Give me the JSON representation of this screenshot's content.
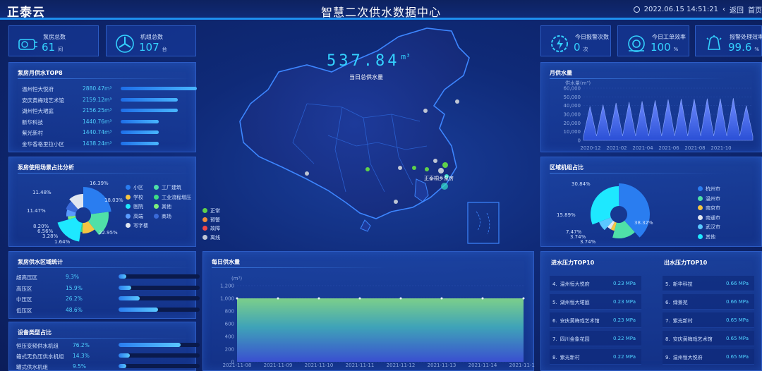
{
  "header": {
    "logo": "正泰云",
    "title": "智慧二次供水数据中心",
    "datetime": "2022.06.15 14:51:21",
    "back_label": "返回",
    "home_label": "首页"
  },
  "left_stats": [
    {
      "label": "泵房总数",
      "value": "61",
      "unit": "间",
      "icon": "pump-room-icon"
    },
    {
      "label": "机组总数",
      "value": "107",
      "unit": "台",
      "icon": "fan-unit-icon"
    }
  ],
  "right_stats": [
    {
      "label": "今日报警次数",
      "value": "0",
      "unit": "次",
      "icon": "alarm-gear-icon"
    },
    {
      "label": "今日工单效率",
      "value": "100",
      "unit": "%",
      "icon": "workorder-icon"
    },
    {
      "label": "报警处理效率",
      "value": "99.6",
      "unit": "%",
      "icon": "alarm-handle-icon"
    }
  ],
  "top8": {
    "title": "泵房月供水TOP8",
    "items": [
      {
        "name": "温州恒大悦府",
        "value": "2880.47m³",
        "ratio": 1.0
      },
      {
        "name": "安庆黄梅戏艺术馆",
        "value": "2159.12m³",
        "ratio": 0.75
      },
      {
        "name": "湖州恒大珺庭",
        "value": "2156.25m³",
        "ratio": 0.75
      },
      {
        "name": "新华科技",
        "value": "1440.76m³",
        "ratio": 0.5
      },
      {
        "name": "紫光新村",
        "value": "1440.74m³",
        "ratio": 0.5
      },
      {
        "name": "金华香格里拉小区",
        "value": "1438.24m³",
        "ratio": 0.5
      }
    ]
  },
  "scene_pie": {
    "title": "泵房使用场景占比分析",
    "labels": [
      "16.39%",
      "18.03%",
      "22.95%",
      "1.64%",
      "3.28%",
      "6.56%",
      "8.20%",
      "11.47%",
      "11.48%"
    ],
    "legend": [
      {
        "name": "小区",
        "color": "#2a7df0"
      },
      {
        "name": "工厂建筑",
        "color": "#4fe0a8"
      },
      {
        "name": "学校",
        "color": "#f5c542"
      },
      {
        "name": "工业流程增压",
        "color": "#3ddc84"
      },
      {
        "name": "医院",
        "color": "#1ee8ff"
      },
      {
        "name": "其他",
        "color": "#7cf07c"
      },
      {
        "name": "高端",
        "color": "#5a9cff"
      },
      {
        "name": "商场",
        "color": "#3a6ad8"
      },
      {
        "name": "写字楼",
        "color": "#e0e6f0"
      }
    ]
  },
  "map": {
    "total_value": "537.84",
    "total_unit": "m³",
    "total_label": "当日总供水量",
    "marker_label": "正泰桐乡泵房",
    "legend": [
      {
        "name": "正常",
        "color": "#5fd14a"
      },
      {
        "name": "预警",
        "color": "#f08a3c"
      },
      {
        "name": "故障",
        "color": "#f04848"
      },
      {
        "name": "离线",
        "color": "#bfc6d4"
      }
    ]
  },
  "zone": {
    "title": "泵房供水区域统计",
    "items": [
      {
        "name": "超高压区",
        "value": "9.3%",
        "ratio": 0.093
      },
      {
        "name": "高压区",
        "value": "15.9%",
        "ratio": 0.159
      },
      {
        "name": "中压区",
        "value": "26.2%",
        "ratio": 0.262
      },
      {
        "name": "低压区",
        "value": "48.6%",
        "ratio": 0.486
      }
    ]
  },
  "equip": {
    "title": "设备类型占比",
    "items": [
      {
        "name": "恒压变频供水机组",
        "value": "76.2%",
        "ratio": 0.762
      },
      {
        "name": "箱式无负压供水机组",
        "value": "14.3%",
        "ratio": 0.143
      },
      {
        "name": "罐式供水机组",
        "value": "9.5%",
        "ratio": 0.095
      }
    ]
  },
  "monthly": {
    "title": "月供水量",
    "unit": "供水量(m³)",
    "y_ticks": [
      "60,000",
      "50,000",
      "40,000",
      "30,000",
      "20,000",
      "10,000",
      "0"
    ],
    "x_ticks": [
      "2020-12",
      "2021-02",
      "2021-04",
      "2021-06",
      "2021-08",
      "2021-10"
    ]
  },
  "region_pie": {
    "title": "区域机组占比",
    "labels": [
      "30.84%",
      "15.89%",
      "7.47%",
      "3.74%",
      "3.74%",
      "38.32%"
    ],
    "legend": [
      {
        "name": "杭州市",
        "color": "#2a7df0"
      },
      {
        "name": "温州市",
        "color": "#4fe0a8"
      },
      {
        "name": "南京市",
        "color": "#f5c542"
      },
      {
        "name": "南通市",
        "color": "#e0e6f0"
      },
      {
        "name": "武汉市",
        "color": "#5ac8ff"
      },
      {
        "name": "其他",
        "color": "#1ee8ff"
      }
    ]
  },
  "daily": {
    "title": "每日供水量",
    "unit": "(m³)",
    "y_ticks": [
      "1,200",
      "1,000",
      "800",
      "600",
      "400",
      "200",
      "0"
    ],
    "x_ticks": [
      "2021-11-08",
      "2021-11-09",
      "2021-11-10",
      "2021-11-11",
      "2021-11-12",
      "2021-11-13",
      "2021-11-14",
      "2021-11-15"
    ]
  },
  "inlet": {
    "title": "进水压力TOP10",
    "items": [
      {
        "rank": "4.",
        "name": "温州恒大悦府",
        "value": "0.23 MPa"
      },
      {
        "rank": "5.",
        "name": "湖州恒大珺庭",
        "value": "0.23 MPa"
      },
      {
        "rank": "6.",
        "name": "安庆黄梅戏艺术馆",
        "value": "0.23 MPa"
      },
      {
        "rank": "7.",
        "name": "四川金象花园",
        "value": "0.22 MPa"
      },
      {
        "rank": "8.",
        "name": "紫光新村",
        "value": "0.22 MPa"
      }
    ]
  },
  "outlet": {
    "title": "出水压力TOP10",
    "items": [
      {
        "rank": "5.",
        "name": "新华科技",
        "value": "0.66 MPa"
      },
      {
        "rank": "6.",
        "name": "绿景苑",
        "value": "0.66 MPa"
      },
      {
        "rank": "7.",
        "name": "紫光新村",
        "value": "0.65 MPa"
      },
      {
        "rank": "8.",
        "name": "安庆黄梅戏艺术馆",
        "value": "0.65 MPa"
      },
      {
        "rank": "9.",
        "name": "温州恒大悦府",
        "value": "0.65 MPa"
      }
    ]
  },
  "chart_data": [
    {
      "type": "area",
      "title": "月供水量",
      "ylabel": "供水量(m³)",
      "ylim": [
        0,
        60000
      ],
      "x_ticks": [
        "2020-12",
        "2021-02",
        "2021-04",
        "2021-06",
        "2021-08",
        "2021-10"
      ],
      "series": [
        {
          "values": [
            5000,
            39000,
            5000,
            41000,
            5000,
            43000,
            5000,
            44000,
            5000,
            45000,
            5000,
            46000,
            5000,
            47000,
            5000,
            47500,
            5000,
            47500,
            5000,
            48000,
            5000,
            48000,
            5000,
            48500,
            5000,
            40000,
            5000
          ]
        }
      ]
    },
    {
      "type": "area",
      "title": "每日供水量",
      "ylabel": "(m³)",
      "ylim": [
        0,
        1200
      ],
      "categories": [
        "2021-11-08",
        "2021-11-09",
        "2021-11-10",
        "2021-11-11",
        "2021-11-12",
        "2021-11-13",
        "2021-11-14",
        "2021-11-15"
      ],
      "series": [
        {
          "values": [
            1000,
            1000,
            1000,
            1000,
            1000,
            1000,
            1000,
            1000
          ]
        }
      ]
    },
    {
      "type": "pie",
      "title": "泵房使用场景占比分析",
      "categories": [
        "小区",
        "工厂建筑",
        "学校",
        "工业流程增压",
        "医院",
        "其他",
        "高端",
        "商场",
        "写字楼"
      ],
      "values": [
        22.95,
        16.39,
        11.48,
        1.64,
        18.03,
        3.28,
        6.56,
        8.2,
        11.47
      ]
    },
    {
      "type": "pie",
      "title": "区域机组占比",
      "categories": [
        "杭州市",
        "温州市",
        "南京市",
        "南通市",
        "武汉市",
        "其他"
      ],
      "values": [
        38.32,
        15.89,
        3.74,
        3.74,
        7.47,
        30.84
      ]
    }
  ]
}
